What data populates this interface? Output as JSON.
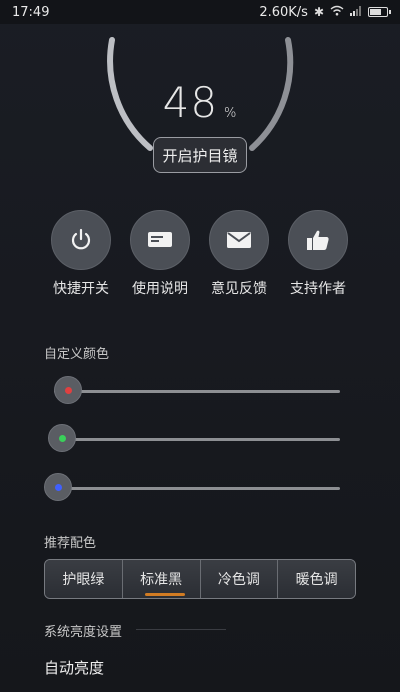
{
  "status_bar": {
    "time": "17:49",
    "speed": "2.60K/s",
    "icons": [
      "bluetooth-icon",
      "wifi-icon",
      "signal-icon",
      "battery-icon"
    ]
  },
  "brightness": {
    "value": "48",
    "unit": "%",
    "level": 0.48
  },
  "eye_button": {
    "label": "开启护目镜"
  },
  "actions": [
    {
      "label": "快捷开关",
      "icon": "power-icon"
    },
    {
      "label": "使用说明",
      "icon": "help-card-icon"
    },
    {
      "label": "意见反馈",
      "icon": "mail-icon"
    },
    {
      "label": "支持作者",
      "icon": "thumbs-up-icon"
    }
  ],
  "custom_color": {
    "title": "自定义颜色",
    "sliders": [
      {
        "channel": "red",
        "color": "#e04040",
        "level": 0.0
      },
      {
        "channel": "green",
        "color": "#3ad05a",
        "level": 0.0
      },
      {
        "channel": "blue",
        "color": "#4060ff",
        "level": 0.0
      }
    ]
  },
  "recommended": {
    "title": "推荐配色",
    "options": [
      "护眼绿",
      "标准黑",
      "冷色调",
      "暖色调"
    ],
    "selected": "标准黑"
  },
  "system_brightness": {
    "title": "系统亮度设置",
    "auto_label": "自动亮度"
  },
  "colors": {
    "background": "#181a20",
    "button_bg": "#4b4f56",
    "accent": "#f08a20"
  }
}
